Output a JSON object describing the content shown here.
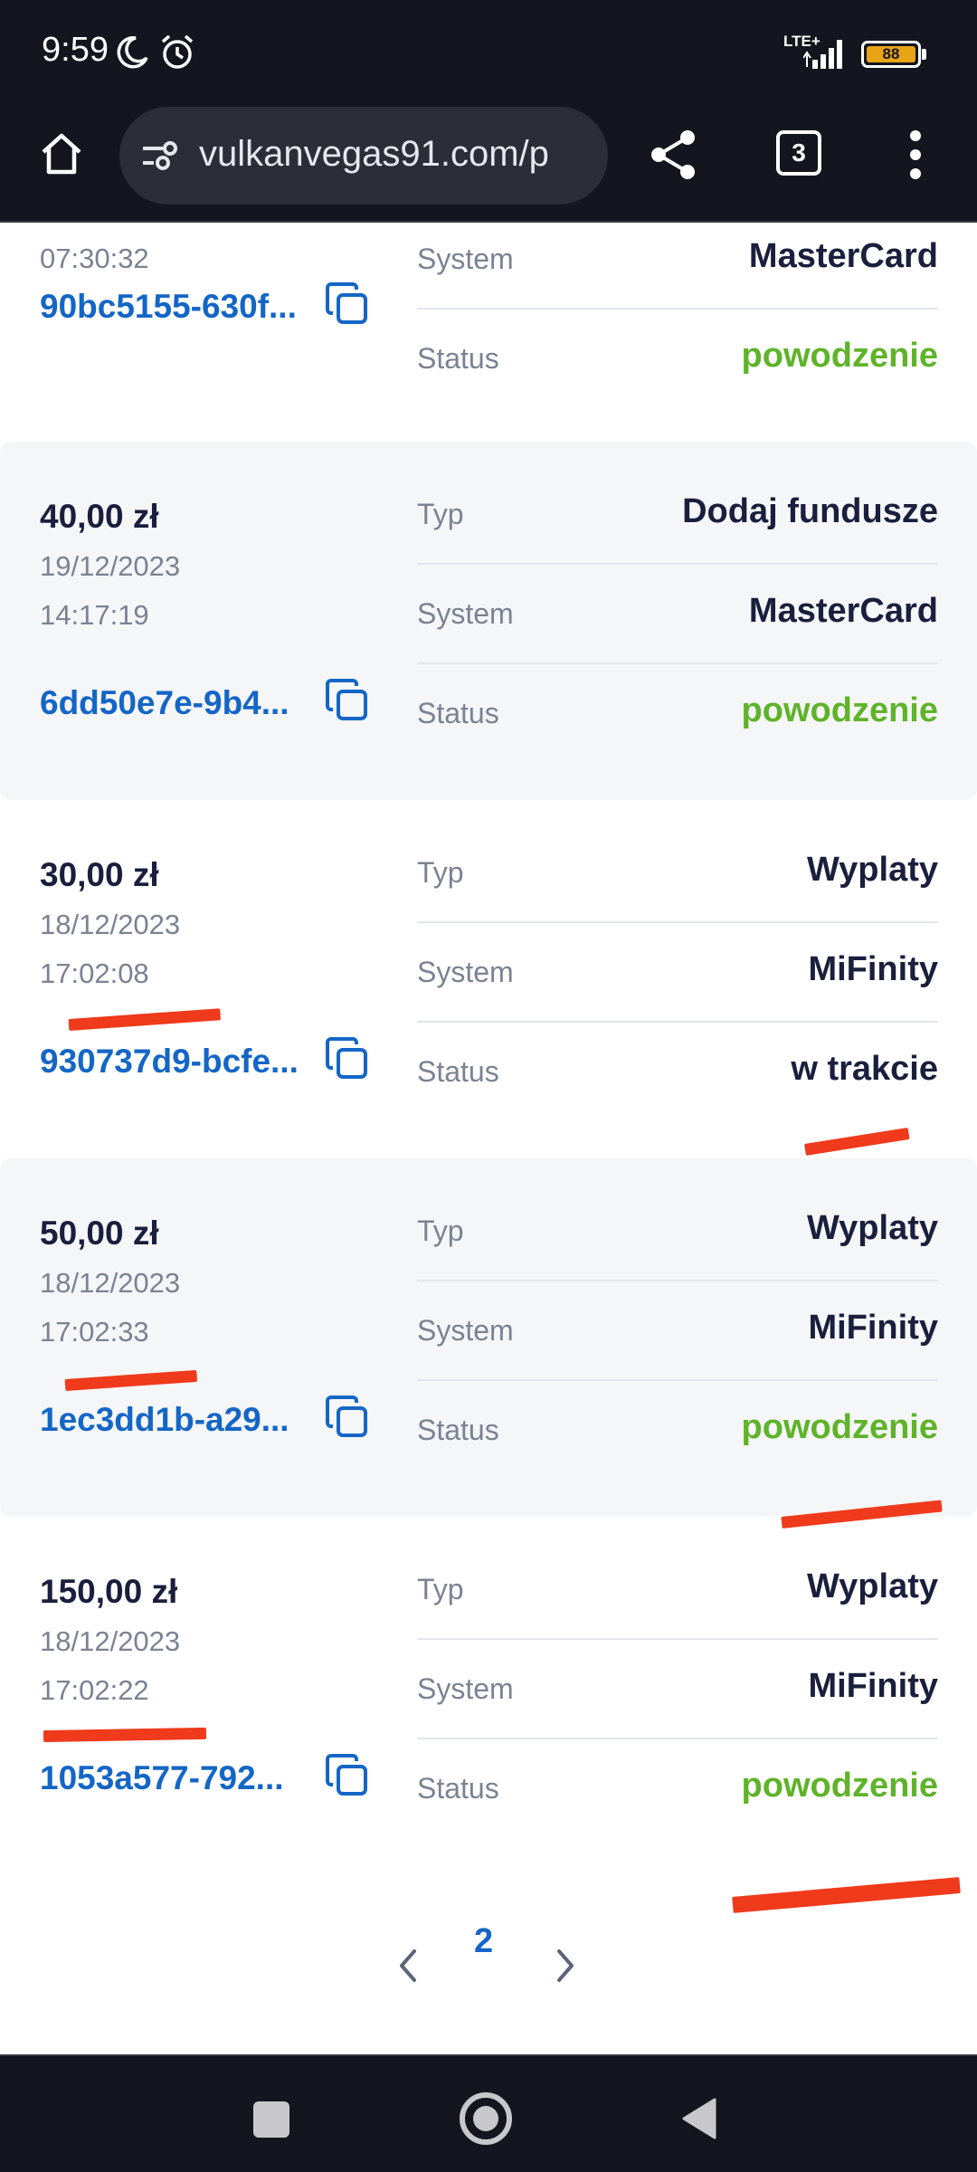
{
  "status_bar": {
    "time": "9:59",
    "network": "LTE+",
    "battery": "88"
  },
  "browser": {
    "url": "vulkanvegas91.com/p",
    "tab_count": "3"
  },
  "transactions": [
    {
      "amount": "",
      "date": "",
      "time": "07:30:32",
      "id": "90bc5155-630f...",
      "rows": [
        {
          "label": "System",
          "value": "MasterCard"
        },
        {
          "label": "Status",
          "value": "powodzenie"
        }
      ]
    },
    {
      "amount": "40,00 zł",
      "date": "19/12/2023",
      "time": "14:17:19",
      "id": "6dd50e7e-9b4...",
      "rows": [
        {
          "label": "Typ",
          "value": "Dodaj fundusze"
        },
        {
          "label": "System",
          "value": "MasterCard"
        },
        {
          "label": "Status",
          "value": "powodzenie"
        }
      ]
    },
    {
      "amount": "30,00 zł",
      "date": "18/12/2023",
      "time": "17:02:08",
      "id": "930737d9-bcfe...",
      "rows": [
        {
          "label": "Typ",
          "value": "Wyplaty"
        },
        {
          "label": "System",
          "value": "MiFinity"
        },
        {
          "label": "Status",
          "value": "w trakcie"
        }
      ]
    },
    {
      "amount": "50,00 zł",
      "date": "18/12/2023",
      "time": "17:02:33",
      "id": "1ec3dd1b-a29...",
      "rows": [
        {
          "label": "Typ",
          "value": "Wyplaty"
        },
        {
          "label": "System",
          "value": "MiFinity"
        },
        {
          "label": "Status",
          "value": "powodzenie"
        }
      ]
    },
    {
      "amount": "150,00 zł",
      "date": "18/12/2023",
      "time": "17:02:22",
      "id": "1053a577-792...",
      "rows": [
        {
          "label": "Typ",
          "value": "Wyplaty"
        },
        {
          "label": "System",
          "value": "MiFinity"
        },
        {
          "label": "Status",
          "value": "powodzenie"
        }
      ]
    }
  ],
  "pagination": {
    "current_page": "2"
  },
  "colors": {
    "success": "#5fb32a",
    "link": "#1466c6",
    "annotation": "#ef3a1c"
  }
}
